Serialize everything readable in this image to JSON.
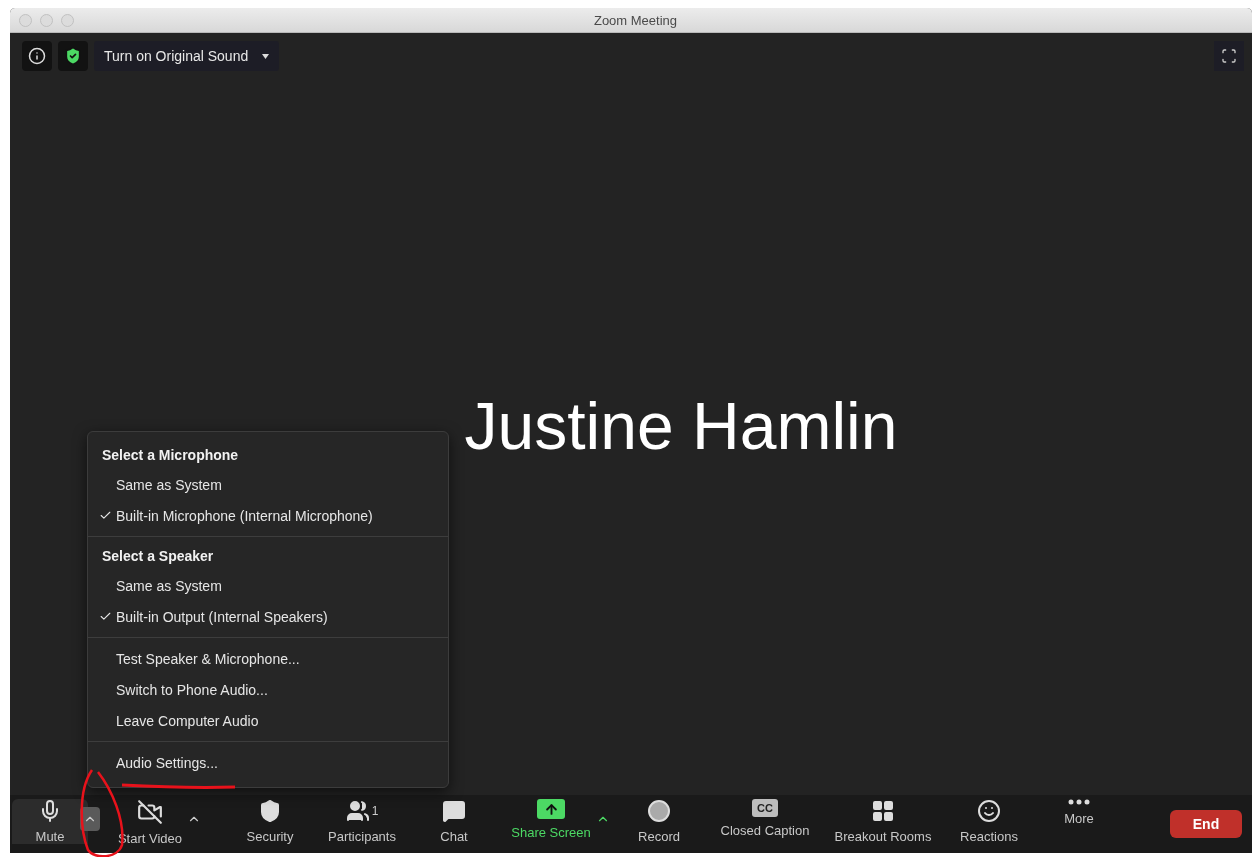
{
  "window": {
    "title": "Zoom Meeting"
  },
  "top_bar": {
    "original_sound": "Turn on Original Sound",
    "secure": true
  },
  "participant_name": "Justine Hamlin",
  "audio_menu": {
    "sections": [
      {
        "heading": "Select a Microphone",
        "items": [
          {
            "label": "Same as System",
            "checked": false
          },
          {
            "label": "Built-in Microphone (Internal Microphone)",
            "checked": true
          }
        ]
      },
      {
        "heading": "Select a Speaker",
        "items": [
          {
            "label": "Same as System",
            "checked": false
          },
          {
            "label": "Built-in Output (Internal Speakers)",
            "checked": true
          }
        ]
      },
      {
        "items": [
          {
            "label": "Test Speaker & Microphone...",
            "checked": false
          },
          {
            "label": "Switch to Phone Audio...",
            "checked": false
          },
          {
            "label": "Leave Computer Audio",
            "checked": false
          }
        ]
      },
      {
        "items": [
          {
            "label": "Audio Settings...",
            "checked": false
          }
        ]
      }
    ]
  },
  "toolbar": {
    "buttons": [
      {
        "kind": "mic",
        "label": "Mute",
        "selected": true,
        "caret_expanded": true
      },
      {
        "kind": "video",
        "label": "Start Video",
        "selected": false,
        "caret_expanded": false
      },
      {
        "kind": "security",
        "label": "Security",
        "selected": false
      },
      {
        "kind": "participants",
        "label": "Participants",
        "count": "1",
        "selected": false
      },
      {
        "kind": "chat",
        "label": "Chat",
        "selected": false
      },
      {
        "kind": "share",
        "label": "Share Screen",
        "selected": false,
        "caret_expanded": false
      },
      {
        "kind": "record",
        "label": "Record",
        "selected": false
      },
      {
        "kind": "cc",
        "label": "Closed Caption",
        "badge": "CC",
        "selected": false
      },
      {
        "kind": "breakout",
        "label": "Breakout Rooms",
        "selected": false
      },
      {
        "kind": "reactions",
        "label": "Reactions",
        "selected": false
      },
      {
        "kind": "more",
        "label": "More",
        "selected": false
      }
    ],
    "end": "End"
  }
}
